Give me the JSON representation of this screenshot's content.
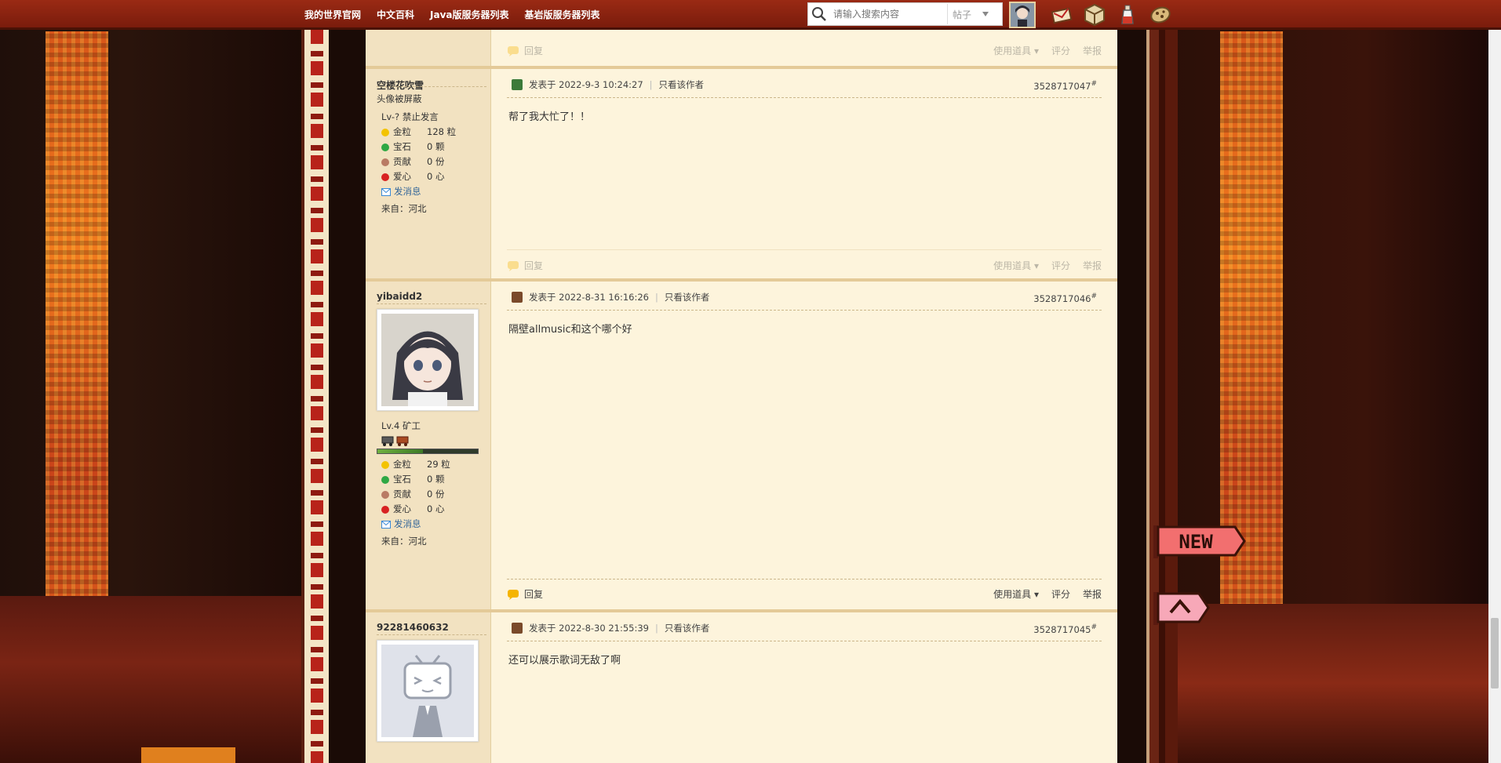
{
  "nav": {
    "links": [
      "我的世界官网",
      "中文百科",
      "Java版服务器列表",
      "基岩版服务器列表"
    ],
    "search_placeholder": "请输入搜索内容",
    "search_type": "帖子"
  },
  "top_post_footer": {
    "reply": "回复",
    "tools": "使用道具",
    "rate": "评分",
    "report": "举报"
  },
  "posts": [
    {
      "author": "空楼花吹雪",
      "avatar_text": "头像被屏蔽",
      "level": "Lv-? 禁止发言",
      "stats": [
        {
          "label": "金粒",
          "value": "128 粒"
        },
        {
          "label": "宝石",
          "value": "0 颗"
        },
        {
          "label": "贡献",
          "value": "0 份"
        },
        {
          "label": "爱心",
          "value": "0 心"
        }
      ],
      "message": "发消息",
      "from": "来自：河北",
      "posted": "发表于 2022-9-3 10:24:27",
      "only_author": "只看该作者",
      "floor": "3528717047",
      "floor_mark": "#",
      "content": "帮了我大忙了！！",
      "footer": {
        "reply": "回复",
        "tools": "使用道具",
        "rate": "评分",
        "report": "举报"
      }
    },
    {
      "author": "yibaidd2",
      "level": "Lv.4 矿工",
      "progress": 0.45,
      "stats": [
        {
          "label": "金粒",
          "value": "29 粒"
        },
        {
          "label": "宝石",
          "value": "0 颗"
        },
        {
          "label": "贡献",
          "value": "0 份"
        },
        {
          "label": "爱心",
          "value": "0 心"
        }
      ],
      "message": "发消息",
      "from": "来自：河北",
      "posted": "发表于 2022-8-31 16:16:26",
      "only_author": "只看该作者",
      "floor": "3528717046",
      "floor_mark": "#",
      "content": "隔壁allmusic和这个哪个好",
      "footer": {
        "reply": "回复",
        "tools": "使用道具",
        "rate": "评分",
        "report": "举报"
      }
    },
    {
      "author": "92281460632",
      "posted": "发表于 2022-8-30 21:55:39",
      "only_author": "只看该作者",
      "floor": "3528717045",
      "floor_mark": "#",
      "content": "还可以展示歌词无敌了啊"
    }
  ],
  "floaters": {
    "new_label": "NEW"
  }
}
